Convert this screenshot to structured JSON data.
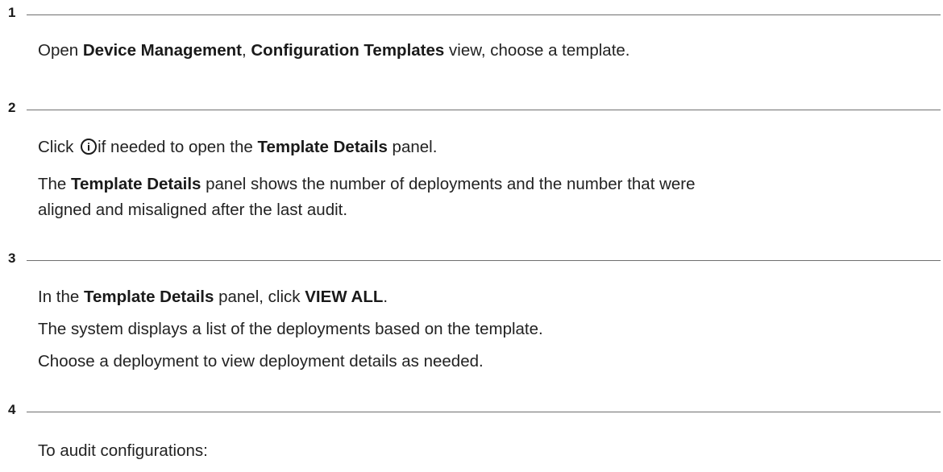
{
  "steps": [
    {
      "number": "1",
      "paragraphs": [
        {
          "runs": [
            {
              "text": "Open "
            },
            {
              "text": "Device Management",
              "bold": true
            },
            {
              "text": ", "
            },
            {
              "text": "Configuration Templates",
              "bold": true
            },
            {
              "text": " view, choose a template."
            }
          ]
        }
      ]
    },
    {
      "number": "2",
      "paragraphs": [
        {
          "runs": [
            {
              "text": "Click "
            },
            {
              "icon": "info-icon"
            },
            {
              "text": "if needed to open the "
            },
            {
              "text": "Template Details",
              "bold": true
            },
            {
              "text": " panel."
            }
          ]
        },
        {
          "runs": [
            {
              "text": "The "
            },
            {
              "text": "Template Details",
              "bold": true
            },
            {
              "text": " panel shows the number of deployments and the number that were"
            }
          ]
        },
        {
          "runs": [
            {
              "text": "aligned and misaligned after the last audit."
            }
          ]
        }
      ]
    },
    {
      "number": "3",
      "paragraphs": [
        {
          "runs": [
            {
              "text": "In the "
            },
            {
              "text": "Template Details",
              "bold": true
            },
            {
              "text": " panel, click "
            },
            {
              "text": "VIEW ALL",
              "bold": true
            },
            {
              "text": "."
            }
          ]
        },
        {
          "runs": [
            {
              "text": "The system displays a list of the deployments based on the template."
            }
          ]
        },
        {
          "runs": [
            {
              "text": "Choose a deployment to view deployment details as needed."
            }
          ]
        }
      ]
    },
    {
      "number": "4",
      "paragraphs": [
        {
          "runs": [
            {
              "text": "To audit configurations:"
            }
          ]
        }
      ]
    }
  ]
}
